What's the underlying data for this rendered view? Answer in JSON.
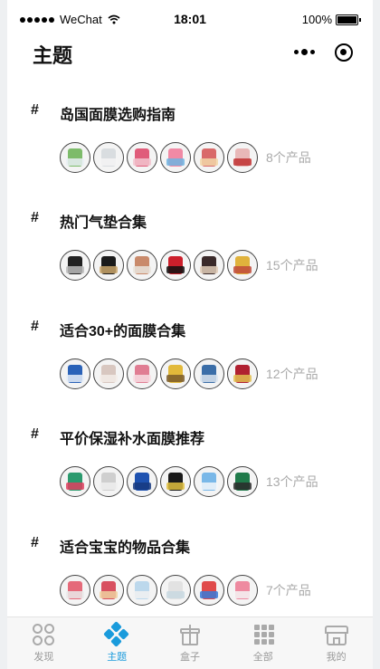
{
  "status_bar": {
    "carrier": "WeChat",
    "time": "18:01",
    "battery": "100%",
    "battery_level": 1.0
  },
  "header": {
    "title": "主题",
    "more_icon": "more-dots-icon",
    "close_icon": "target-circle-icon"
  },
  "topics": [
    {
      "hash": "#",
      "title": "岛国面膜选购指南",
      "count": "8个产品",
      "thumb_colors": [
        [
          "#7dbb6a",
          "#e8eef3"
        ],
        [
          "#d9dde0",
          "#f5f5f5"
        ],
        [
          "#e05c7a",
          "#f2c4cf"
        ],
        [
          "#f08aa5",
          "#6fb3e0"
        ],
        [
          "#d96a6a",
          "#f2d7a8"
        ],
        [
          "#e8b8b8",
          "#c03030"
        ]
      ]
    },
    {
      "hash": "#",
      "title": "热门气垫合集",
      "count": "15个产品",
      "thumb_colors": [
        [
          "#222222",
          "#bbbbbb"
        ],
        [
          "#1b1b1b",
          "#c9a56a"
        ],
        [
          "#c98a6b",
          "#e9e4dd"
        ],
        [
          "#cc1f2b",
          "#111111"
        ],
        [
          "#3a2a2a",
          "#e0ccb8"
        ],
        [
          "#e0b23c",
          "#c04a3a"
        ]
      ]
    },
    {
      "hash": "#",
      "title": "适合30+的面膜合集",
      "count": "12个产品",
      "thumb_colors": [
        [
          "#2a62b8",
          "#e6eef8"
        ],
        [
          "#d8c7c0",
          "#f3ece8"
        ],
        [
          "#e07d93",
          "#f7dde3"
        ],
        [
          "#e2b93a",
          "#7a5a2a"
        ],
        [
          "#3b6ea8",
          "#dbe4ee"
        ],
        [
          "#b02030",
          "#e2c050"
        ]
      ]
    },
    {
      "hash": "#",
      "title": "平价保湿补水面膜推荐",
      "count": "13个产品",
      "thumb_colors": [
        [
          "#2b9a6e",
          "#e04060"
        ],
        [
          "#cfcfcf",
          "#efefef"
        ],
        [
          "#1e52b0",
          "#183a80"
        ],
        [
          "#1a1a1a",
          "#e0c040"
        ],
        [
          "#7ab8e8",
          "#f2f6fa"
        ],
        [
          "#1f7a4a",
          "#2a2a2a"
        ]
      ]
    },
    {
      "hash": "#",
      "title": "适合宝宝的物品合集",
      "count": "7个产品",
      "thumb_colors": [
        [
          "#e56a7a",
          "#eaeaea"
        ],
        [
          "#d85060",
          "#f0d0a0"
        ],
        [
          "#bcd8ec",
          "#f2f2f2"
        ],
        [
          "#e2e2e2",
          "#c8d8e0"
        ],
        [
          "#e04a4a",
          "#3a7ad8"
        ],
        [
          "#ee8aa0",
          "#f4f4f4"
        ]
      ]
    }
  ],
  "tabbar": {
    "tabs": [
      {
        "label": "发现",
        "icon": "discover-circles-icon",
        "active": false
      },
      {
        "label": "主题",
        "icon": "topic-diamonds-icon",
        "active": true
      },
      {
        "label": "盒子",
        "icon": "gift-box-icon",
        "active": false
      },
      {
        "label": "全部",
        "icon": "grid-all-icon",
        "active": false
      },
      {
        "label": "我的",
        "icon": "shop-store-icon",
        "active": false
      }
    ],
    "active_color": "#1a9bdc",
    "inactive_color": "#999999"
  }
}
